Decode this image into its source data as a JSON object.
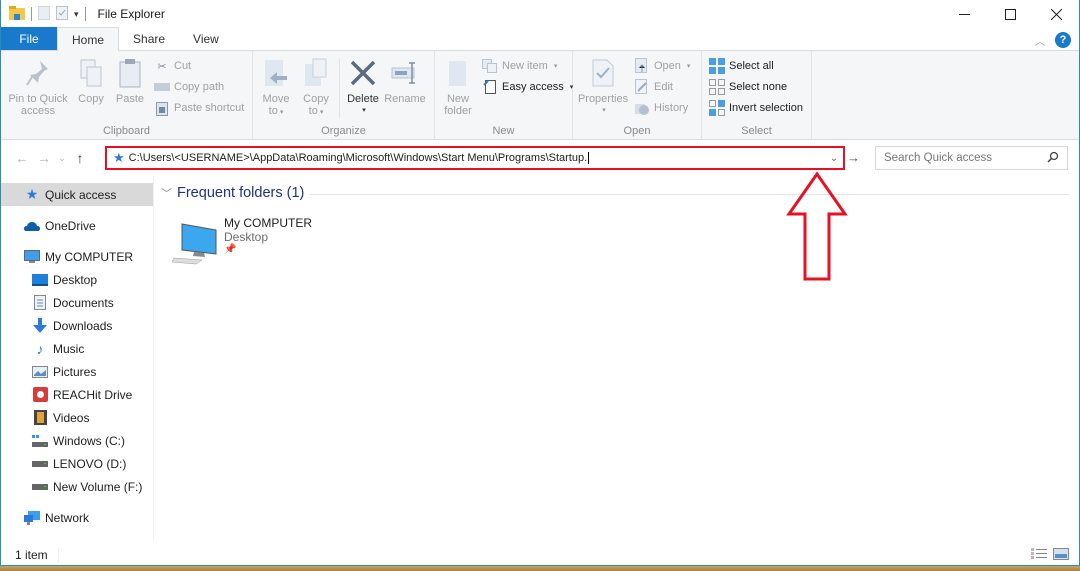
{
  "window": {
    "title": "File Explorer",
    "controls": {
      "minimize": "minimize-icon",
      "maximize": "maximize-icon",
      "close": "close-icon"
    }
  },
  "ribbon": {
    "tabs": [
      {
        "label": "File",
        "active": false
      },
      {
        "label": "Home",
        "active": true
      },
      {
        "label": "Share",
        "active": false
      },
      {
        "label": "View",
        "active": false
      }
    ],
    "groups": {
      "clipboard": {
        "label": "Clipboard",
        "pin": "Pin to Quick access",
        "pin_line1": "Pin to Quick",
        "pin_line2": "access",
        "copy": "Copy",
        "paste": "Paste",
        "cut": "Cut",
        "copy_path": "Copy path",
        "paste_shortcut": "Paste shortcut"
      },
      "organize": {
        "label": "Organize",
        "move_line1": "Move",
        "move_line2": "to",
        "copy_line1": "Copy",
        "copy_line2": "to",
        "delete": "Delete",
        "rename": "Rename"
      },
      "new": {
        "label": "New",
        "new_folder_line1": "New",
        "new_folder_line2": "folder",
        "new_item": "New item",
        "easy_access": "Easy access"
      },
      "open": {
        "label": "Open",
        "properties": "Properties",
        "open": "Open",
        "edit": "Edit",
        "history": "History"
      },
      "select": {
        "label": "Select",
        "select_all": "Select all",
        "select_none": "Select none",
        "invert_selection": "Invert selection"
      }
    }
  },
  "address_bar": {
    "path": "C:\\Users\\<USERNAME>\\AppData\\Roaming\\Microsoft\\Windows\\Start Menu\\Programs\\Startup.",
    "highlight_color": "#e81123"
  },
  "search": {
    "placeholder": "Search Quick access"
  },
  "sidebar": {
    "items": [
      {
        "label": "Quick access",
        "icon": "star-icon",
        "level": 0,
        "selected": true
      },
      {
        "label": "OneDrive",
        "icon": "cloud-icon",
        "level": 0
      },
      {
        "label": "My COMPUTER",
        "icon": "computer-icon",
        "level": 0
      },
      {
        "label": "Desktop",
        "icon": "desktop-icon",
        "level": 1
      },
      {
        "label": "Documents",
        "icon": "documents-icon",
        "level": 1
      },
      {
        "label": "Downloads",
        "icon": "downloads-icon",
        "level": 1
      },
      {
        "label": "Music",
        "icon": "music-icon",
        "level": 1
      },
      {
        "label": "Pictures",
        "icon": "pictures-icon",
        "level": 1
      },
      {
        "label": "REACHit Drive",
        "icon": "reachit-drive-icon",
        "level": 1
      },
      {
        "label": "Videos",
        "icon": "videos-icon",
        "level": 1
      },
      {
        "label": "Windows (C:)",
        "icon": "windows-drive-icon",
        "level": 1
      },
      {
        "label": "LENOVO (D:)",
        "icon": "drive-icon",
        "level": 1
      },
      {
        "label": "New Volume (F:)",
        "icon": "drive-icon",
        "level": 1
      },
      {
        "label": "Network",
        "icon": "network-icon",
        "level": 0
      }
    ]
  },
  "content": {
    "section_title": "Frequent folders (1)",
    "items": [
      {
        "name": "My COMPUTER",
        "location": "Desktop",
        "pinned": true
      }
    ]
  },
  "status": {
    "item_count": "1 item"
  },
  "colors": {
    "accent": "#1979ca",
    "section_header": "#1e3287",
    "annotation": "#e81123"
  }
}
